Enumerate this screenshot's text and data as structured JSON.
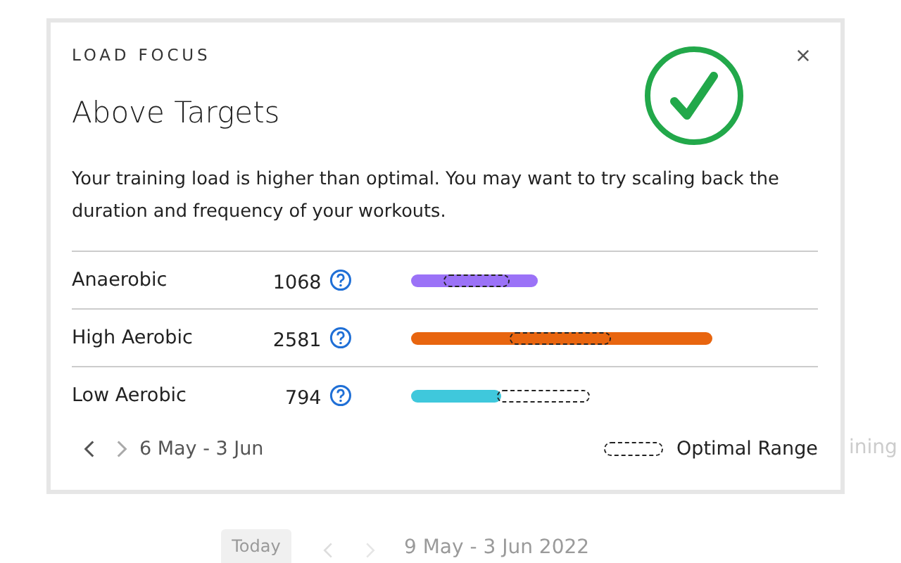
{
  "background": {
    "side_text": "ining",
    "today_button": "Today",
    "date_range": "9 May - 3 Jun 2022"
  },
  "dialog": {
    "eyebrow": "LOAD FOCUS",
    "title": "Above Targets",
    "description": "Your training load is higher than optimal. You may want to try scaling back the duration and frequency of your workouts.",
    "rows": [
      {
        "label": "Anaerobic",
        "value": "1068",
        "color": "#9b72f7"
      },
      {
        "label": "High Aerobic",
        "value": "2581",
        "color": "#e8650f"
      },
      {
        "label": "Low Aerobic",
        "value": "794",
        "color": "#3fc8dc"
      }
    ],
    "period": "6 May - 3 Jun",
    "prev_disabled": false,
    "next_disabled": true,
    "legend": "Optimal Range"
  }
}
